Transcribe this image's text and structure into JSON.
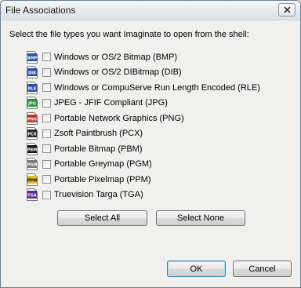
{
  "window": {
    "title": "File Associations"
  },
  "instruction": "Select the file types you want Imaginate to open from the shell:",
  "file_types": [
    {
      "icon_text": "BMP",
      "icon": "bmp-file-icon",
      "color": "#2c4fa3",
      "label": "Windows or OS/2 Bitmap (BMP)",
      "checked": false
    },
    {
      "icon_text": "DIB",
      "icon": "dib-file-icon",
      "color": "#2c4fa3",
      "label": "Windows or OS/2 DIBitmap (DIB)",
      "checked": false
    },
    {
      "icon_text": "RLE",
      "icon": "rle-file-icon",
      "color": "#2c4fa3",
      "label": "Windows or CompuServe Run Length Encoded (RLE)",
      "checked": false
    },
    {
      "icon_text": "JPG",
      "icon": "jpg-file-icon",
      "color": "#2f8f3c",
      "label": "JPEG - JFIF Compliant (JPG)",
      "checked": false
    },
    {
      "icon_text": "PNG",
      "icon": "png-file-icon",
      "color": "#c0302c",
      "label": "Portable Network Graphics (PNG)",
      "checked": false
    },
    {
      "icon_text": "PCX",
      "icon": "pcx-file-icon",
      "color": "#2a2a2a",
      "label": "Zsoft Paintbrush (PCX)",
      "checked": false
    },
    {
      "icon_text": "PBM",
      "icon": "pbm-file-icon",
      "color": "#1a1a1a",
      "label": "Portable Bitmap (PBM)",
      "checked": false
    },
    {
      "icon_text": "PGM",
      "icon": "pgm-file-icon",
      "color": "#7a7a7a",
      "label": "Portable Greymap (PGM)",
      "checked": false
    },
    {
      "icon_text": "PPM",
      "icon": "ppm-file-icon",
      "color": "#e0c020",
      "label": "Portable Pixelmap (PPM)",
      "checked": false
    },
    {
      "icon_text": "TGA",
      "icon": "tga-file-icon",
      "color": "#5a2a8a",
      "label": "Truevision Targa (TGA)",
      "checked": false
    }
  ],
  "buttons": {
    "select_all": "Select All",
    "select_none": "Select None",
    "ok": "OK",
    "cancel": "Cancel"
  }
}
